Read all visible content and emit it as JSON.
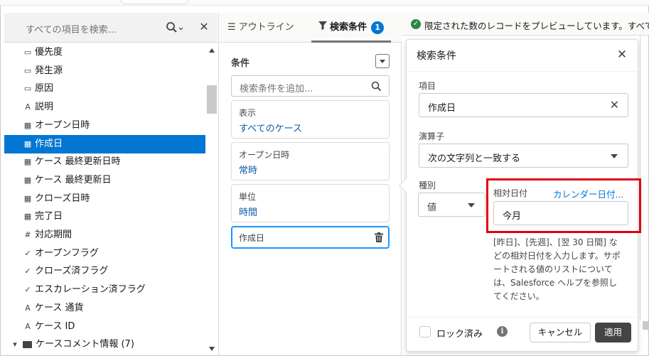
{
  "left_panel": {
    "search_placeholder": "すべての項目を検索...",
    "fields": [
      {
        "icon": "text-field-icon",
        "glyph": "▭",
        "label": "優先度"
      },
      {
        "icon": "text-field-icon",
        "glyph": "▭",
        "label": "発生源"
      },
      {
        "icon": "text-field-icon",
        "glyph": "▭",
        "label": "原因"
      },
      {
        "icon": "string-icon",
        "glyph": "A",
        "label": "説明"
      },
      {
        "icon": "calendar-icon",
        "glyph": "▦",
        "label": "オープン日時"
      },
      {
        "icon": "calendar-icon",
        "glyph": "▦",
        "label": "作成日"
      },
      {
        "icon": "calendar-icon",
        "glyph": "▦",
        "label": "ケース 最終更新日時"
      },
      {
        "icon": "calendar-icon",
        "glyph": "▦",
        "label": "ケース 最終更新日"
      },
      {
        "icon": "calendar-icon",
        "glyph": "▦",
        "label": "クローズ日時"
      },
      {
        "icon": "calendar-icon",
        "glyph": "▦",
        "label": "完了日"
      },
      {
        "icon": "number-icon",
        "glyph": "#",
        "label": "対応期間"
      },
      {
        "icon": "check-icon",
        "glyph": "✓",
        "label": "オープンフラグ"
      },
      {
        "icon": "check-icon",
        "glyph": "✓",
        "label": "クローズ済フラグ"
      },
      {
        "icon": "check-icon",
        "glyph": "✓",
        "label": "エスカレーション済フラグ"
      },
      {
        "icon": "string-icon",
        "glyph": "A",
        "label": "ケース 通貨"
      },
      {
        "icon": "string-icon",
        "glyph": "A",
        "label": "ケース ID"
      },
      {
        "icon": "folder-icon",
        "glyph": "▾",
        "label": "ケースコメント情報 (7)"
      }
    ],
    "selected_index": 5
  },
  "middle_panel": {
    "tabs": {
      "outline_label": "アウトライン",
      "filters_label": "検索条件",
      "filters_count": "1"
    },
    "conditions_title": "条件",
    "add_filter_placeholder": "検索条件を追加...",
    "filters": [
      {
        "key": "表示",
        "value": "すべてのケース"
      },
      {
        "key": "オープン日時",
        "value": "常時"
      },
      {
        "key": "単位",
        "value": "時間"
      }
    ],
    "active_filter_label": "作成日"
  },
  "notice": {
    "text": "限定された数のレコードをプレビューしています。すべての"
  },
  "popover": {
    "title": "検索条件",
    "field_label": "項目",
    "field_value": "作成日",
    "operator_label": "演算子",
    "operator_value": "次の文字列と一致する",
    "type_label": "種別",
    "type_value": "値",
    "relative_label": "相対日付",
    "calendar_link": "カレンダー日付...",
    "relative_value": "今月",
    "help_text": "[昨日]、[先週]、[翌 30 日間] などの相対日付を入力します。サポートされる値のリストについては、Salesforce ヘルプを参照してください。",
    "lock_label": "ロック済み",
    "cancel_label": "キャンセル",
    "apply_label": "適用"
  },
  "colors": {
    "selection": "#0176d3",
    "link": "#0176d3",
    "highlight_box": "#e3000f",
    "apply_button": "#444444"
  }
}
